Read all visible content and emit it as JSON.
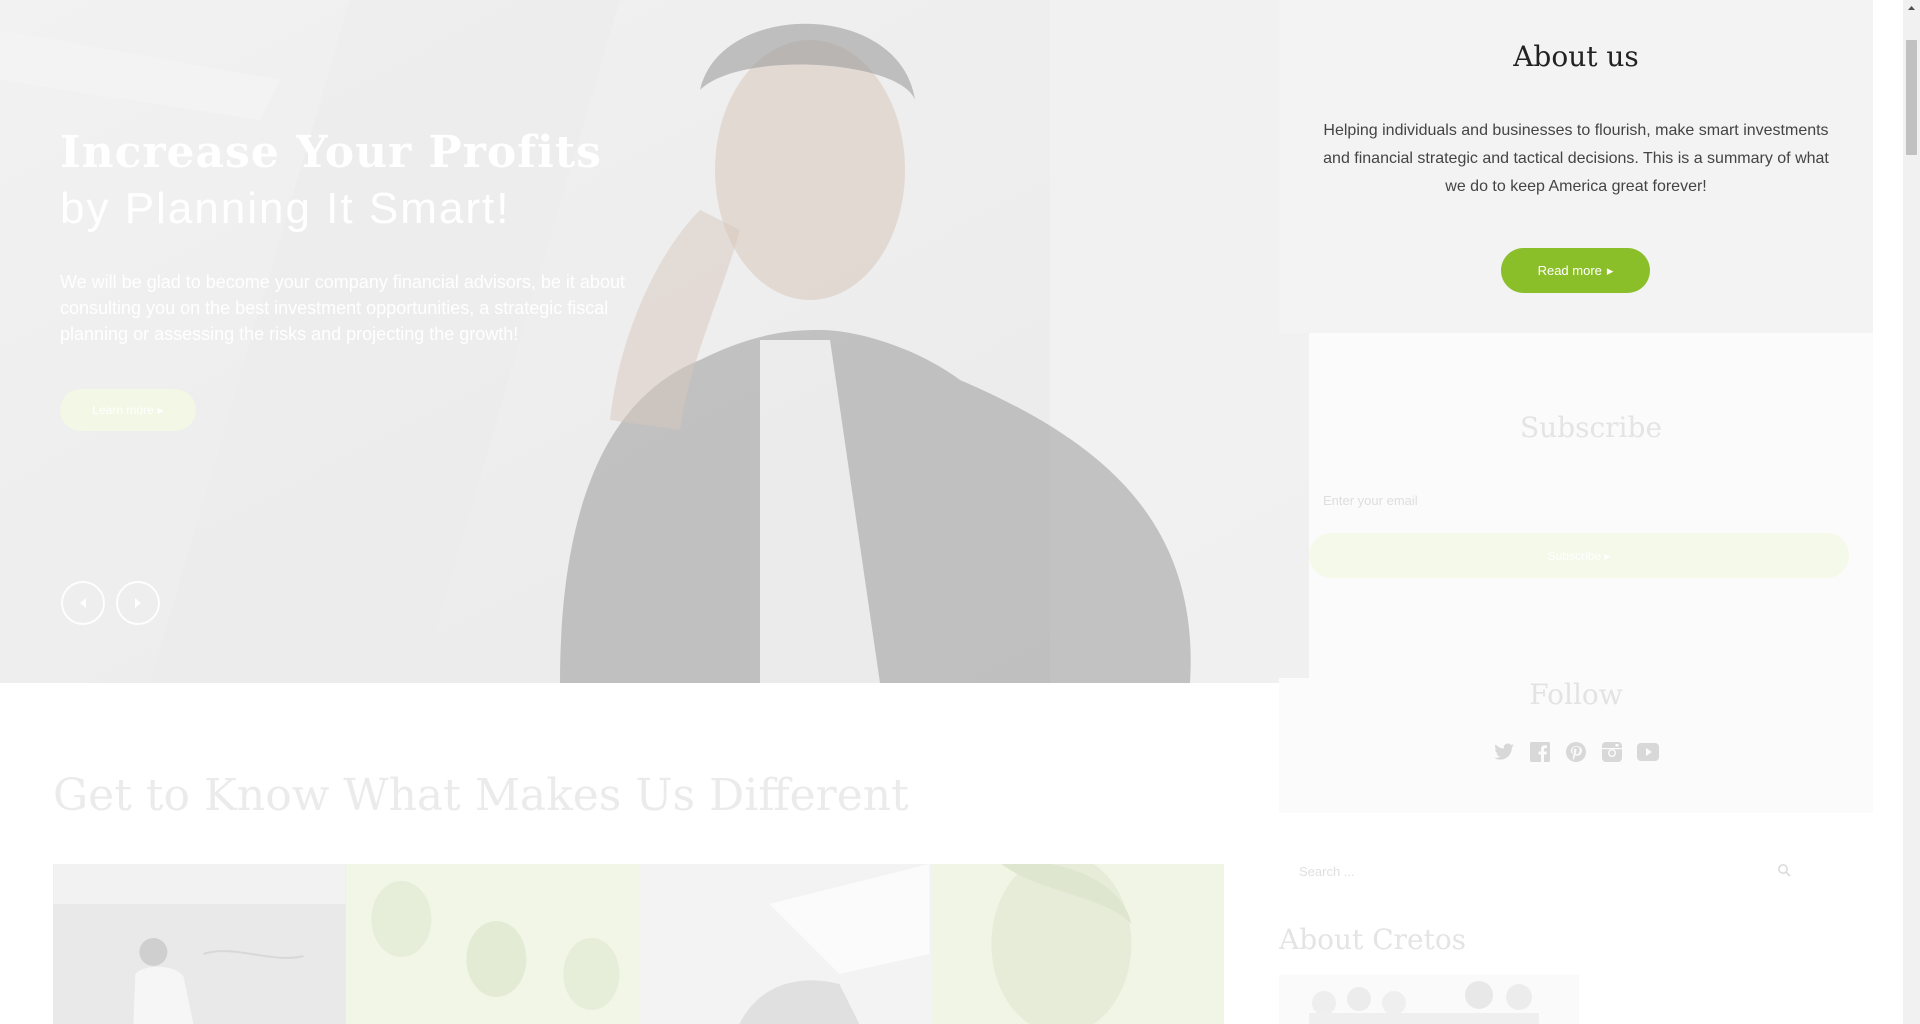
{
  "hero": {
    "title_line1": "Increase Your Profits",
    "title_line2": "by Planning It Smart!",
    "text": "We will be glad to become your company financial advisors, be it about consulting you on the best investment opportunities, a strategic fiscal planning or assessing the risks and projecting the growth!",
    "button_label": "Learn more",
    "prev_icon": "chevron-left-icon",
    "next_icon": "chevron-right-icon"
  },
  "about": {
    "title": "About us",
    "text": "Helping individuals and businesses to flourish, make smart investments and financial strategic and tactical decisions. This is a summary of what we do to keep America great forever!",
    "button_label": "Read more"
  },
  "subscribe": {
    "title": "Subscribe",
    "email_placeholder": "Enter your email",
    "button_label": "Subscribe"
  },
  "follow": {
    "title": "Follow",
    "icons": [
      "twitter-icon",
      "facebook-icon",
      "pinterest-icon",
      "instagram-icon",
      "youtube-icon"
    ]
  },
  "search": {
    "placeholder": "Search ..."
  },
  "about_cretos": {
    "title": "About Cretos"
  },
  "main": {
    "section_title": "Get to Know What Makes Us Different"
  },
  "colors": {
    "accent": "#8bbf2a",
    "panel": "#f3f3f3",
    "tile_green": "#f1f6e7"
  }
}
